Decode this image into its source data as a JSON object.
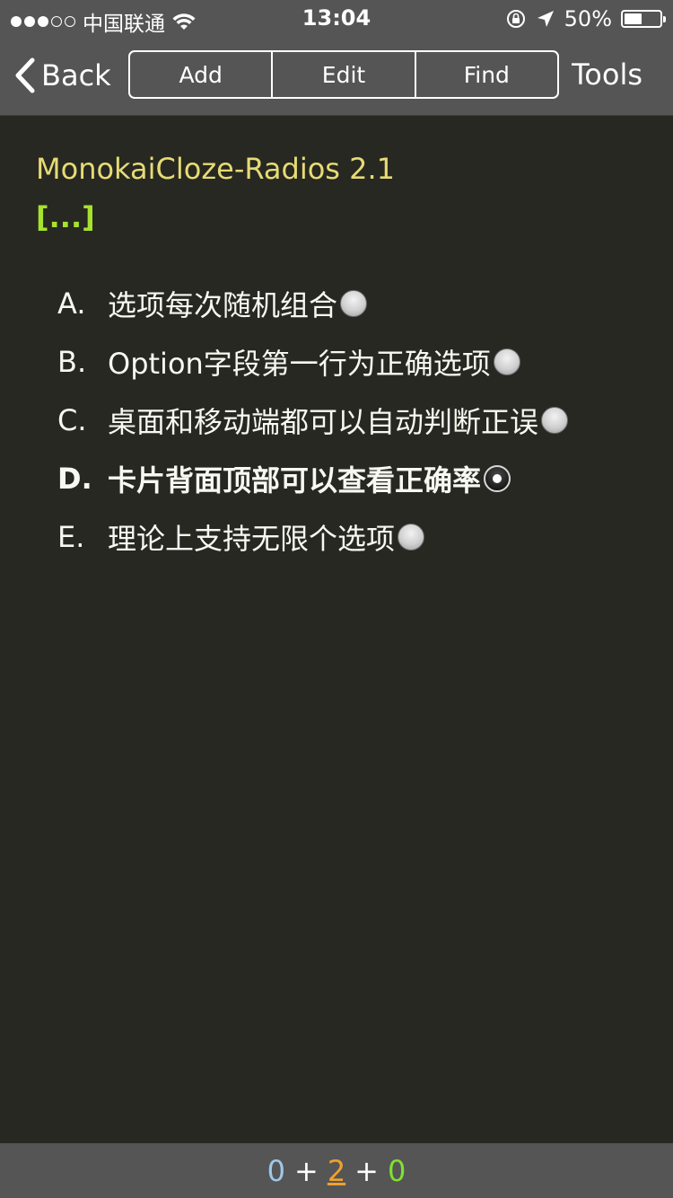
{
  "status_bar": {
    "carrier": "中国联通",
    "time": "13:04",
    "battery_percent": "50%",
    "battery_level": 0.5
  },
  "nav": {
    "back_label": "Back",
    "segments": [
      "Add",
      "Edit",
      "Find"
    ],
    "tools_label": "Tools"
  },
  "card": {
    "title": "MonokaiCloze-Radios 2.1",
    "cloze": "[...]",
    "options": [
      {
        "letter": "A.",
        "text": "选项每次随机组合",
        "checked": false
      },
      {
        "letter": "B.",
        "text": "Option字段第一行为正确选项",
        "checked": false
      },
      {
        "letter": "C.",
        "text": "桌面和移动端都可以自动判断正误",
        "checked": false
      },
      {
        "letter": "D.",
        "text": "卡片背面顶部可以查看正确率",
        "checked": true
      },
      {
        "letter": "E.",
        "text": "理论上支持无限个选项",
        "checked": false
      }
    ]
  },
  "counts": {
    "new": "0",
    "plus1": "+",
    "learn": "2",
    "plus2": "+",
    "review": "0"
  },
  "colors": {
    "background": "#272822",
    "bar": "#555555",
    "title": "#e6db74",
    "cloze": "#a6e22e",
    "new_count": "#9ec8e8",
    "learn_count": "#f0a030",
    "review_count": "#7ee22e"
  },
  "icons": [
    "wifi-icon",
    "orientation-lock-icon",
    "location-arrow-icon",
    "battery-icon",
    "chevron-left-icon",
    "radio-icon"
  ]
}
